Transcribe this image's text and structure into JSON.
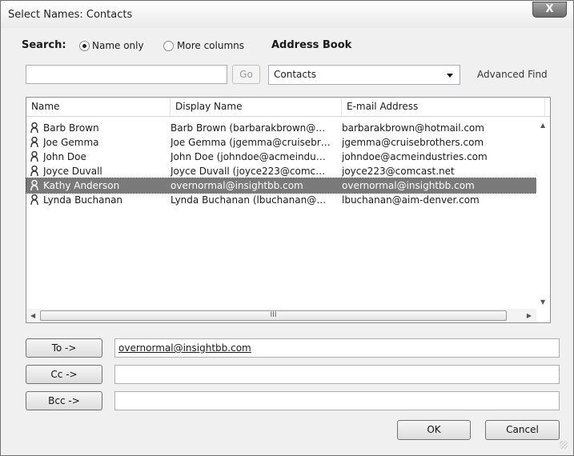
{
  "window": {
    "title": "Select Names: Contacts",
    "close_glyph": "X"
  },
  "search": {
    "label": "Search:",
    "option_name_only": "Name only",
    "option_more_columns": "More columns",
    "selected_option": "Name only",
    "input_value": "",
    "go_label": "Go"
  },
  "address_book": {
    "label": "Address Book",
    "selected": "Contacts",
    "advanced_find": "Advanced Find"
  },
  "list": {
    "columns": [
      "Name",
      "Display Name",
      "E-mail Address"
    ],
    "rows": [
      {
        "name": "Barb Brown",
        "display": "Barb Brown (barbarakbrown@…",
        "email": "barbarakbrown@hotmail.com",
        "icon": "contact-person-icon",
        "selected": false
      },
      {
        "name": "Joe Gemma",
        "display": "Joe Gemma (jgemma@cruisebr…",
        "email": "jgemma@cruisebrothers.com",
        "icon": "contact-person-icon",
        "selected": false
      },
      {
        "name": "John Doe",
        "display": "John Doe (johndoe@acmeindu…",
        "email": "johndoe@acmeindustries.com",
        "icon": "contact-person-icon",
        "selected": false
      },
      {
        "name": "Joyce Duvall",
        "display": "Joyce Duvall (joyce223@comc…",
        "email": "joyce223@comcast.net",
        "icon": "contact-person-icon",
        "selected": false
      },
      {
        "name": "Kathy Anderson",
        "display": "overnormal@insightbb.com",
        "email": "overnormal@insightbb.com",
        "icon": "contact-person-icon",
        "selected": true
      },
      {
        "name": "Lynda Buchanan",
        "display": "Lynda Buchanan (lbuchanan@…",
        "email": "lbuchanan@aim-denver.com",
        "icon": "contact-person-icon",
        "selected": false
      }
    ],
    "hscroll_thumb_glyph": "III"
  },
  "recipients": {
    "to_label": "To ->",
    "to_value": "overnormal@insightbb.com",
    "cc_label": "Cc ->",
    "cc_value": "",
    "bcc_label": "Bcc ->",
    "bcc_value": ""
  },
  "actions": {
    "ok": "OK",
    "cancel": "Cancel"
  },
  "colors": {
    "selected_row": "#7a7a7a",
    "window_bg": "#f0f0f0"
  }
}
